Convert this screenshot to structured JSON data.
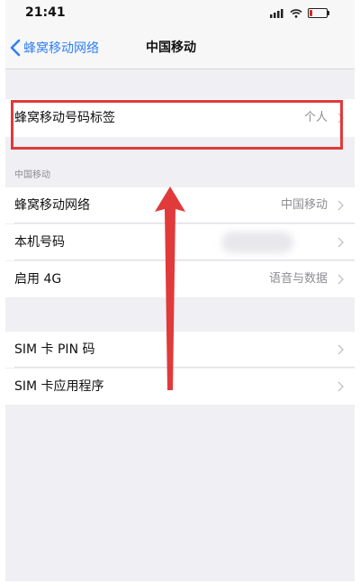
{
  "status_bar": {
    "time": "21:41"
  },
  "nav": {
    "back_label": "蜂窝移动网络",
    "title": "中国移动"
  },
  "group1": {
    "label_row": {
      "label": "蜂窝移动号码标签",
      "value": "个人"
    }
  },
  "group2": {
    "header": "中国移动",
    "rows": [
      {
        "label": "蜂窝移动网络",
        "value": "中国移动"
      },
      {
        "label": "本机号码",
        "value": ""
      },
      {
        "label": "启用 4G",
        "value": "语音与数据"
      }
    ]
  },
  "group3": {
    "rows": [
      {
        "label": "SIM 卡 PIN 码"
      },
      {
        "label": "SIM 卡应用程序"
      }
    ]
  },
  "annotation": {
    "highlight_color": "#e03a3a",
    "arrow_color": "#e03a3a"
  },
  "colors": {
    "accent": "#2f7ff6",
    "grouped_background": "#efeff4",
    "secondary_text": "#8e8e93"
  }
}
